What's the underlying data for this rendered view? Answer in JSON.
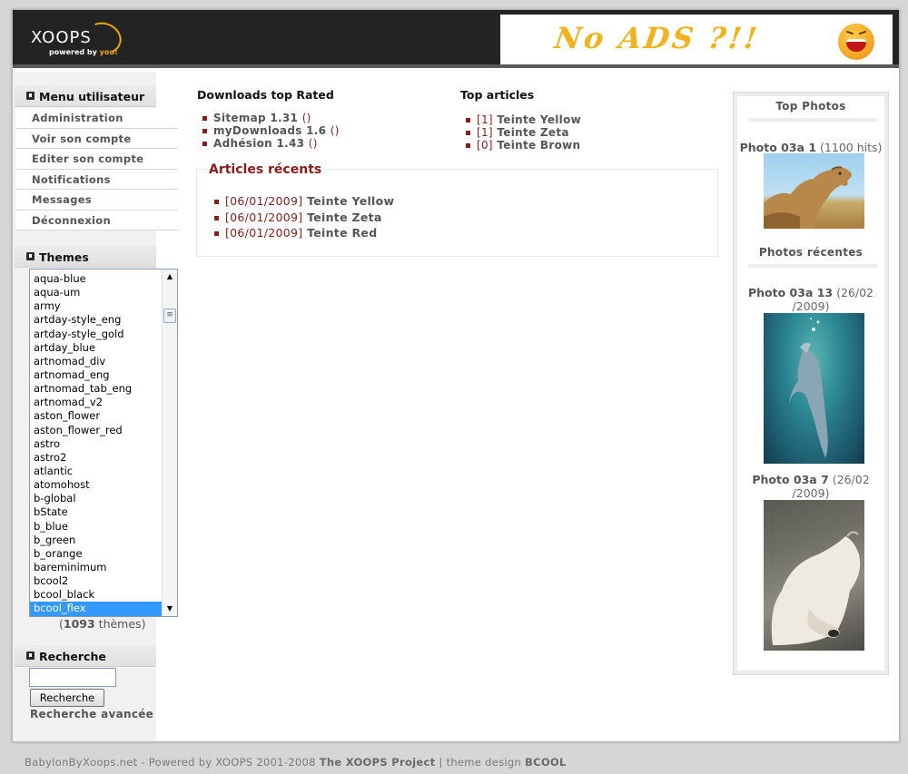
{
  "header": {
    "logo_text": "XOOPS",
    "logo_sub_prefix": "powered by",
    "logo_sub_you": "you!",
    "banner_text": "No ADS ?!!"
  },
  "user_menu": {
    "title": "Menu utilisateur",
    "items": [
      "Administration",
      "Voir son compte",
      "Editer son compte",
      "Notifications",
      "Messages",
      "Déconnexion"
    ]
  },
  "themes": {
    "title": "Themes",
    "options": [
      "aqua-blue",
      "aqua-um",
      "army",
      "artday-style_eng",
      "artday-style_gold",
      "artday_blue",
      "artnomad_div",
      "artnomad_eng",
      "artnomad_tab_eng",
      "artnomad_v2",
      "aston_flower",
      "aston_flower_red",
      "astro",
      "astro2",
      "atlantic",
      "atomohost",
      "b-global",
      "bState",
      "b_blue",
      "b_green",
      "b_orange",
      "bareminimum",
      "bcool2",
      "bcool_black",
      "bcool_flex"
    ],
    "selected": "bcool_flex",
    "count": "1093",
    "count_suffix": "thèmes"
  },
  "search": {
    "title": "Recherche",
    "input_value": "",
    "button_label": "Recherche",
    "advanced_label": "Recherche avancée"
  },
  "downloads": {
    "title": "Downloads top Rated",
    "items": [
      {
        "label": "Sitemap 1.31",
        "paren": "()"
      },
      {
        "label": "myDownloads 1.6",
        "paren": "()"
      },
      {
        "label": "Adhésion 1.43",
        "paren": "()"
      }
    ]
  },
  "top_articles": {
    "title": "Top articles",
    "items": [
      {
        "count": "[1]",
        "label": "Teinte Yellow"
      },
      {
        "count": "[1]",
        "label": "Teinte Zeta"
      },
      {
        "count": "[0]",
        "label": "Teinte Brown"
      }
    ]
  },
  "recent_articles": {
    "title": "Articles récents",
    "items": [
      {
        "date": "[06/01/2009]",
        "label": "Teinte Yellow"
      },
      {
        "date": "[06/01/2009]",
        "label": "Teinte Zeta"
      },
      {
        "date": "[06/01/2009]",
        "label": "Teinte Red"
      }
    ]
  },
  "photos": {
    "top_title": "Top Photos",
    "top_photo": {
      "name": "Photo 03a 1",
      "meta": "(1100 hits)"
    },
    "recent_title": "Photos récentes",
    "recent": [
      {
        "name": "Photo 03a 13",
        "meta_line1": "(26/02",
        "meta_line2": "/2009)"
      },
      {
        "name": "Photo 03a 7",
        "meta_line1": "(26/02",
        "meta_line2": "/2009)"
      }
    ]
  },
  "footer": {
    "prefix": "BabylonByXoops.net - Powered by XOOPS 2001-2008",
    "project": "The XOOPS Project",
    "sep": "| theme design",
    "designer": "BCOOL"
  },
  "colors": {
    "accent_red": "#8b1c1c",
    "header_bg": "#232323",
    "select_highlight": "#3399ff"
  }
}
